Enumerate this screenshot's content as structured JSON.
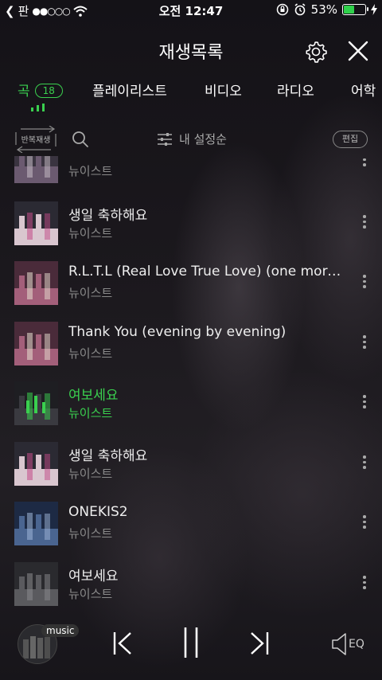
{
  "status_bar": {
    "carrier": "판",
    "time": "오전 12:47",
    "battery_percent": "53%",
    "battery_level": 0.53
  },
  "header": {
    "title": "재생목록"
  },
  "tabs": [
    {
      "label": "곡",
      "count": "18",
      "active": true
    },
    {
      "label": "플레이리스트"
    },
    {
      "label": "비디오"
    },
    {
      "label": "라디오"
    },
    {
      "label": "어학"
    }
  ],
  "toolbar": {
    "repeat_label": "반복재생",
    "sort_label": "내 설정순",
    "edit_label": "편집"
  },
  "songs": [
    {
      "title": "",
      "artist": "뉴이스트"
    },
    {
      "title": "생일 축하해요",
      "artist": "뉴이스트"
    },
    {
      "title": "R.L.T.L (Real Love True Love) (one morn...",
      "artist": "뉴이스트"
    },
    {
      "title": "Thank You (evening by evening)",
      "artist": "뉴이스트"
    },
    {
      "title": "여보세요",
      "artist": "뉴이스트",
      "playing": true
    },
    {
      "title": "생일 축하해요",
      "artist": "뉴이스트"
    },
    {
      "title": "ONEKIS2",
      "artist": "뉴이스트"
    },
    {
      "title": "여보세요",
      "artist": "뉴이스트"
    }
  ],
  "player": {
    "badge": "music",
    "eq_label": "EQ"
  },
  "colors": {
    "accent": "#3ad04f"
  }
}
